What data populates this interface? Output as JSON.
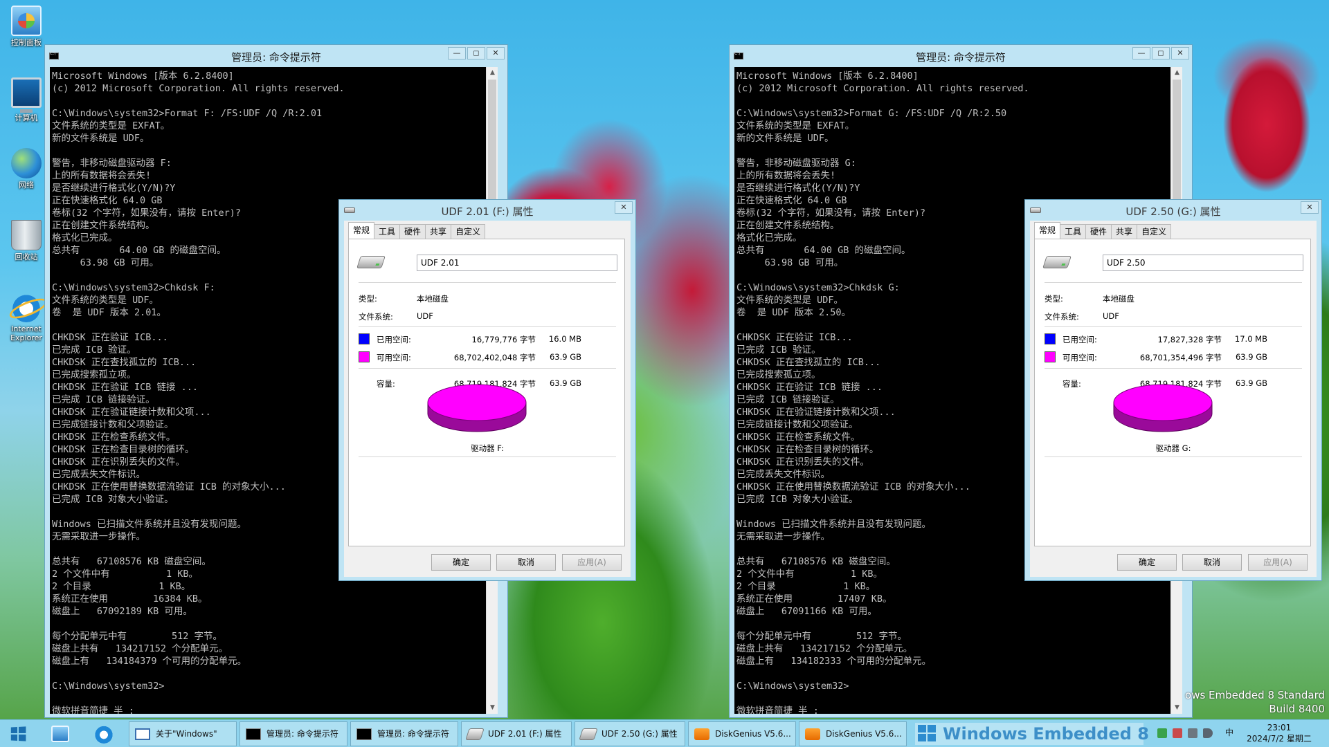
{
  "desktop_icons": [
    {
      "label": "控制面板",
      "icon": "control-panel-icon"
    },
    {
      "label": "计算机",
      "icon": "computer-icon"
    },
    {
      "label": "网络",
      "icon": "network-icon"
    },
    {
      "label": "回收站",
      "icon": "recycle-bin-icon"
    },
    {
      "label": "Internet Explorer",
      "icon": "internet-explorer-icon"
    }
  ],
  "cmd_windows": [
    {
      "title": "管理员: 命令提示符",
      "lines": [
        "Microsoft Windows [版本 6.2.8400]",
        "(c) 2012 Microsoft Corporation. All rights reserved.",
        "",
        "C:\\Windows\\system32>Format F: /FS:UDF /Q /R:2.01",
        "文件系统的类型是 EXFAT。",
        "新的文件系统是 UDF。",
        "",
        "警告，非移动磁盘驱动器 F:",
        "上的所有数据将会丢失!",
        "是否继续进行格式化(Y/N)?Y",
        "正在快速格式化 64.0 GB",
        "卷标(32 个字符，如果没有，请按 Enter)?",
        "正在创建文件系统结构。",
        "格式化已完成。",
        "总共有       64.00 GB 的磁盘空间。",
        "     63.98 GB 可用。",
        "",
        "C:\\Windows\\system32>Chkdsk F:",
        "文件系统的类型是 UDF。",
        "卷  是 UDF 版本 2.01。",
        "",
        "CHKDSK 正在验证 ICB...",
        "已完成 ICB 验证。",
        "CHKDSK 正在查找孤立的 ICB...",
        "已完成搜索孤立项。",
        "CHKDSK 正在验证 ICB 链接 ...",
        "已完成 ICB 链接验证。",
        "CHKDSK 正在验证链接计数和父项...",
        "已完成链接计数和父项验证。",
        "CHKDSK 正在检查系统文件。",
        "CHKDSK 正在检查目录树的循环。",
        "CHKDSK 正在识别丢失的文件。",
        "已完成丢失文件标识。",
        "CHKDSK 正在使用替换数据流验证 ICB 的对象大小...",
        "已完成 ICB 对象大小验证。",
        "",
        "Windows 已扫描文件系统并且没有发现问题。",
        "无需采取进一步操作。",
        "",
        "总共有   67108576 KB 磁盘空间。",
        "2 个文件中有          1 KB。",
        "2 个目录            1 KB。",
        "系统正在使用        16384 KB。",
        "磁盘上   67092189 KB 可用。",
        "",
        "每个分配单元中有        512 字节。",
        "磁盘上共有   134217152 个分配单元。",
        "磁盘上有   134184379 个可用的分配单元。",
        "",
        "C:\\Windows\\system32>",
        "",
        "微软拼音简捷 半 :"
      ]
    },
    {
      "title": "管理员: 命令提示符",
      "lines": [
        "Microsoft Windows [版本 6.2.8400]",
        "(c) 2012 Microsoft Corporation. All rights reserved.",
        "",
        "C:\\Windows\\system32>Format G: /FS:UDF /Q /R:2.50",
        "文件系统的类型是 EXFAT。",
        "新的文件系统是 UDF。",
        "",
        "警告，非移动磁盘驱动器 G:",
        "上的所有数据将会丢失!",
        "是否继续进行格式化(Y/N)?Y",
        "正在快速格式化 64.0 GB",
        "卷标(32 个字符，如果没有，请按 Enter)?",
        "正在创建文件系统结构。",
        "格式化已完成。",
        "总共有       64.00 GB 的磁盘空间。",
        "     63.98 GB 可用。",
        "",
        "C:\\Windows\\system32>Chkdsk G:",
        "文件系统的类型是 UDF。",
        "卷  是 UDF 版本 2.50。",
        "",
        "CHKDSK 正在验证 ICB...",
        "已完成 ICB 验证。",
        "CHKDSK 正在查找孤立的 ICB...",
        "已完成搜索孤立项。",
        "CHKDSK 正在验证 ICB 链接 ...",
        "已完成 ICB 链接验证。",
        "CHKDSK 正在验证链接计数和父项...",
        "已完成链接计数和父项验证。",
        "CHKDSK 正在检查系统文件。",
        "CHKDSK 正在检查目录树的循环。",
        "CHKDSK 正在识别丢失的文件。",
        "已完成丢失文件标识。",
        "CHKDSK 正在使用替换数据流验证 ICB 的对象大小...",
        "已完成 ICB 对象大小验证。",
        "",
        "Windows 已扫描文件系统并且没有发现问题。",
        "无需采取进一步操作。",
        "",
        "总共有   67108576 KB 磁盘空间。",
        "2 个文件中有          1 KB。",
        "2 个目录            1 KB。",
        "系统正在使用        17407 KB。",
        "磁盘上   67091166 KB 可用。",
        "",
        "每个分配单元中有        512 字节。",
        "磁盘上共有   134217152 个分配单元。",
        "磁盘上有   134182333 个可用的分配单元。",
        "",
        "C:\\Windows\\system32>",
        "",
        "微软拼音简捷 半 :"
      ]
    }
  ],
  "dialogs": [
    {
      "title": "UDF 2.01 (F:) 属性",
      "tabs": [
        "常规",
        "工具",
        "硬件",
        "共享",
        "自定义"
      ],
      "active_tab": "常规",
      "volume_name": "UDF 2.01",
      "type_label": "类型:",
      "type_value": "本地磁盘",
      "fs_label": "文件系统:",
      "fs_value": "UDF",
      "used_label": "已用空间:",
      "used_bytes": "16,779,776 字节",
      "used_size": "16.0 MB",
      "free_label": "可用空间:",
      "free_bytes": "68,702,402,048 字节",
      "free_size": "63.9 GB",
      "capacity_label": "容量:",
      "capacity_bytes": "68,719,181,824 字节",
      "capacity_size": "63.9 GB",
      "used_fraction": 0.000244,
      "drive_label": "驱动器 F:",
      "buttons": {
        "ok": "确定",
        "cancel": "取消",
        "apply": "应用(A)"
      }
    },
    {
      "title": "UDF 2.50 (G:) 属性",
      "tabs": [
        "常规",
        "工具",
        "硬件",
        "共享",
        "自定义"
      ],
      "active_tab": "常规",
      "volume_name": "UDF 2.50",
      "type_label": "类型:",
      "type_value": "本地磁盘",
      "fs_label": "文件系统:",
      "fs_value": "UDF",
      "used_label": "已用空间:",
      "used_bytes": "17,827,328 字节",
      "used_size": "17.0 MB",
      "free_label": "可用空间:",
      "free_bytes": "68,701,354,496 字节",
      "free_size": "63.9 GB",
      "capacity_label": "容量:",
      "capacity_bytes": "68,719,181,824 字节",
      "capacity_size": "63.9 GB",
      "used_fraction": 0.000259,
      "drive_label": "驱动器 G:",
      "buttons": {
        "ok": "确定",
        "cancel": "取消",
        "apply": "应用(A)"
      }
    }
  ],
  "colors": {
    "used": "#0000ff",
    "free": "#ff00ff",
    "pie_side": "#9a0a9a",
    "window_frame": "#bfe4f4"
  },
  "watermark": {
    "line1": "ows Embedded 8 Standard",
    "line2": "Build 8400"
  },
  "taskbar": {
    "buttons": [
      {
        "label": "关于\"Windows\"",
        "icon": "windows-about-icon"
      },
      {
        "label": "管理员: 命令提示符",
        "icon": "cmd-icon"
      },
      {
        "label": "管理员: 命令提示符",
        "icon": "cmd-icon"
      },
      {
        "label": "UDF 2.01 (F:) 属性",
        "icon": "drive-icon"
      },
      {
        "label": "UDF 2.50 (G:) 属性",
        "icon": "drive-icon"
      },
      {
        "label": "DiskGenius V5.6...",
        "icon": "diskgenius-icon"
      },
      {
        "label": "DiskGenius V5.6...",
        "icon": "diskgenius-icon"
      }
    ],
    "brand_text": "Windows Embedded 8",
    "ime": "中",
    "time": "23:01",
    "date": "2024/7/2 星期二"
  }
}
